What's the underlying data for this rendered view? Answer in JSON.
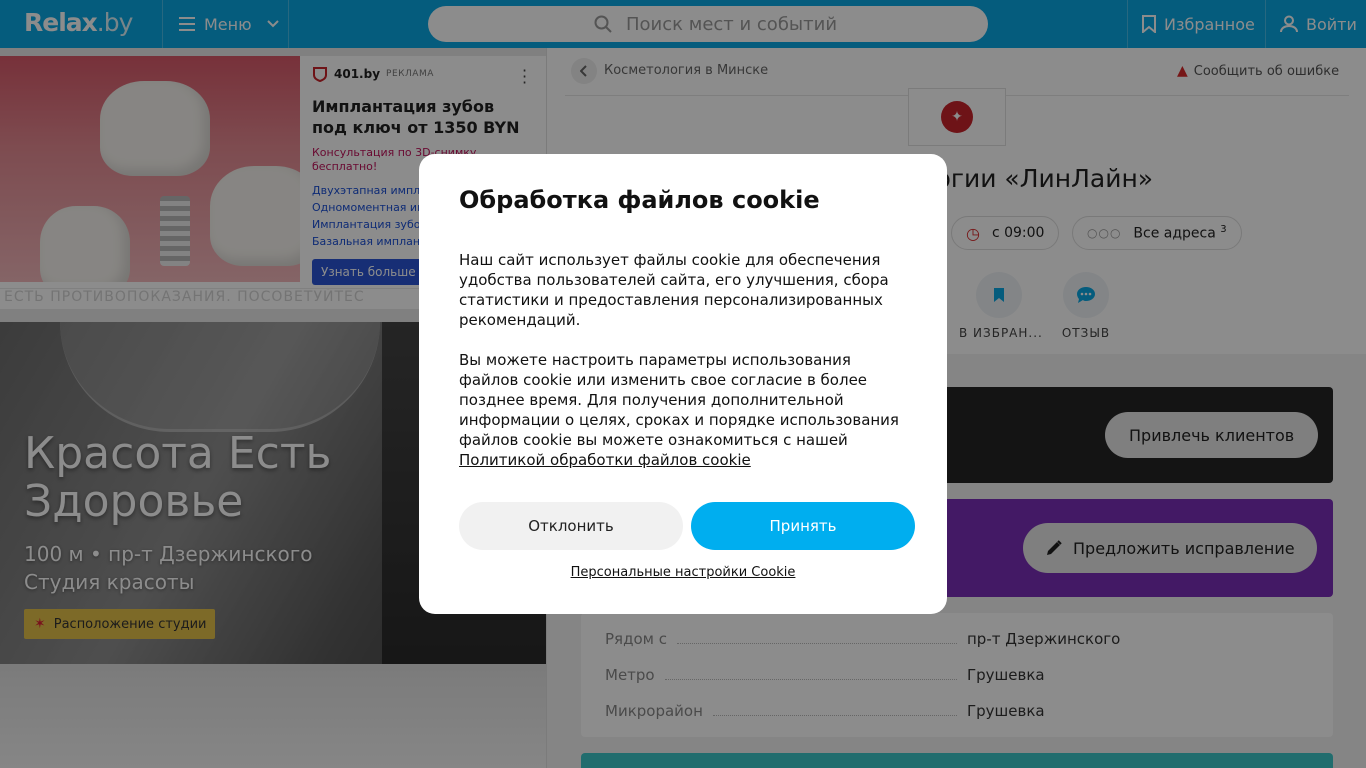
{
  "header": {
    "logo_main": "Relax",
    "logo_suffix": ".by",
    "menu_label": "Меню",
    "search_placeholder": "Поиск мест и событий",
    "favorites_label": "Избранное",
    "login_label": "Войти",
    "brand_color": "#0aa8e3"
  },
  "ad": {
    "brand": "401.by",
    "tag": "РЕКЛАМА",
    "title": "Имплантация зубов под ключ от 1350 BYN",
    "subtitle": "Консультация по 3D-снимку бесплатно!",
    "links": [
      "Двухэтапная импла",
      "Одномоментная им",
      "Имплантация зубов",
      "Базальная имплант"
    ],
    "button": "Узнать больше",
    "disclaimer": "ЕСТЬ ПРОТИВОПОКАЗАНИЯ. ПОСОВЕТУЙТЕС"
  },
  "promo": {
    "title_line1": "Красота Есть",
    "title_line2": "Здоровье",
    "meta_line1": "100 м • пр-т Дзержинского",
    "meta_line2": "Студия красоты",
    "button": "Расположение студии"
  },
  "place": {
    "breadcrumb": "Косметология в Минске",
    "report": "Сообщить об ошибке",
    "title": "ологии и хирургии «ЛинЛайн»",
    "hours_chip": "с 09:00",
    "addresses_chip": "Все адреса",
    "addresses_count": "3",
    "actions": {
      "favorite": "В ИЗБРАН...",
      "review": "ОТЗЫВ"
    },
    "attract_button": "Привлечь клиентов",
    "suggest_button": "Предложить исправление",
    "info": [
      {
        "key": "Рядом с",
        "value": "пр-т Дзержинского"
      },
      {
        "key": "Метро",
        "value": "Грушевка"
      },
      {
        "key": "Микрорайон",
        "value": "Грушевка"
      }
    ]
  },
  "cookie_modal": {
    "title": "Обработка файлов cookie",
    "para1": "Наш сайт использует файлы cookie для обеспечения удобства пользователей сайта, его улучшения, сбора статистики и предоставления персонализированных рекомендаций.",
    "para2": "Вы можете настроить параметры использования файлов cookie или изменить свое согласие в более позднее время. Для получения дополнительной информации о целях, сроках и порядке использования файлов cookie вы можете ознакомиться с нашей",
    "policy_link": "Политикой обработки файлов cookie",
    "decline": "Отклонить",
    "accept": "Принять",
    "settings": "Персональные настройки Cookie",
    "accent_color": "#00aeef"
  }
}
